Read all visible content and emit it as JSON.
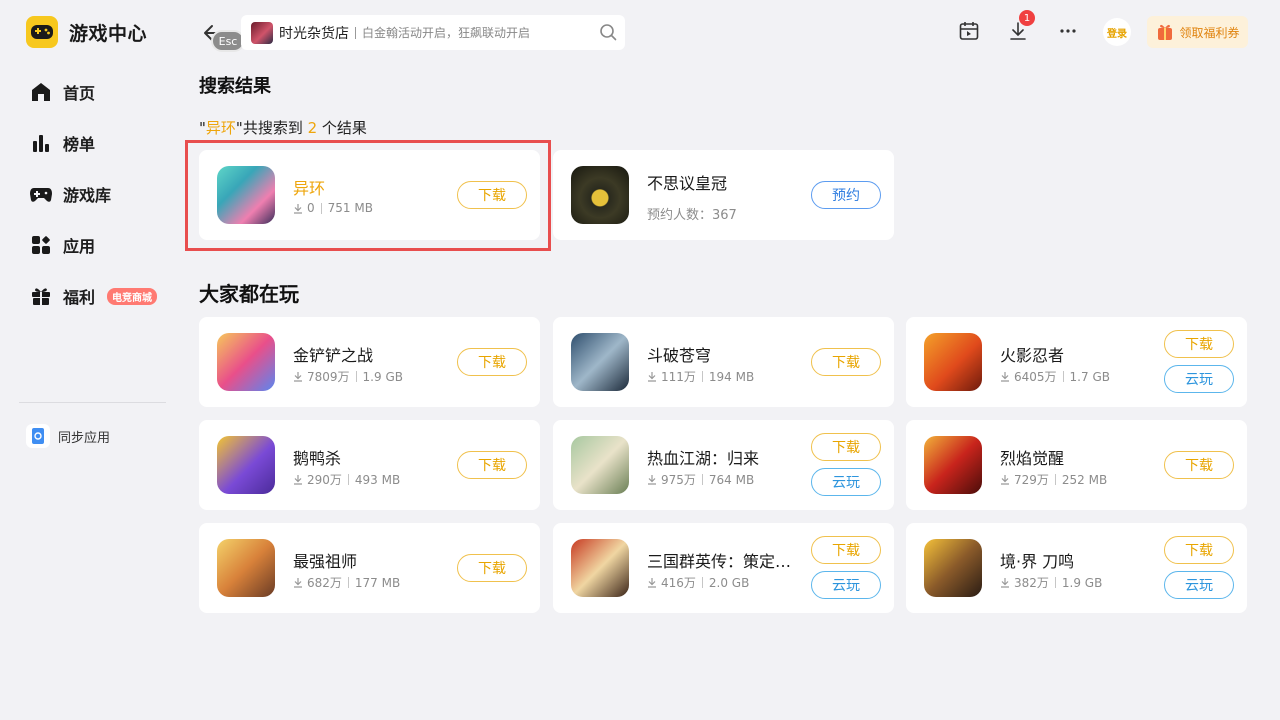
{
  "app": {
    "title": "游戏中心"
  },
  "sidebar": {
    "items": [
      {
        "label": "首页"
      },
      {
        "label": "榜单"
      },
      {
        "label": "游戏库"
      },
      {
        "label": "应用"
      },
      {
        "label": "福利",
        "badge": "电竞商城"
      }
    ],
    "sync_label": "同步应用"
  },
  "topbar": {
    "esc_label": "Esc",
    "search": {
      "hot_word": "时光杂货店",
      "subtext": "白金翰活动开启，狂飙联动开启"
    },
    "download_badge": "1",
    "login_label": "登录",
    "coupon_label": "领取福利券"
  },
  "search_results": {
    "title": "搜索结果",
    "summary": {
      "prefix": "\"",
      "query": "异环",
      "middle": "\"共搜索到 ",
      "count": "2",
      "suffix": " 个结果"
    },
    "items": [
      {
        "name": "异环",
        "downloads": "0",
        "size": "751 MB",
        "button": "下载"
      },
      {
        "name": "不思议皇冠",
        "reserve_text": "预约人数：367",
        "button": "预约"
      }
    ]
  },
  "popular": {
    "title": "大家都在玩",
    "items": [
      {
        "name": "金铲铲之战",
        "downloads": "7809万",
        "size": "1.9 GB",
        "download_label": "下载"
      },
      {
        "name": "斗破苍穹",
        "downloads": "111万",
        "size": "194 MB",
        "download_label": "下载"
      },
      {
        "name": "火影忍者",
        "downloads": "6405万",
        "size": "1.7 GB",
        "download_label": "下载",
        "cloud_label": "云玩"
      },
      {
        "name": "鹅鸭杀",
        "downloads": "290万",
        "size": "493 MB",
        "download_label": "下载"
      },
      {
        "name": "热血江湖：归来",
        "downloads": "975万",
        "size": "764 MB",
        "download_label": "下载",
        "cloud_label": "云玩"
      },
      {
        "name": "烈焰觉醒",
        "downloads": "729万",
        "size": "252 MB",
        "download_label": "下载"
      },
      {
        "name": "最强祖师",
        "downloads": "682万",
        "size": "177 MB",
        "download_label": "下载"
      },
      {
        "name": "三国群英传：策定…",
        "downloads": "416万",
        "size": "2.0 GB",
        "download_label": "下载",
        "cloud_label": "云玩"
      },
      {
        "name": "境·界 刀鸣",
        "downloads": "382万",
        "size": "1.9 GB",
        "download_label": "下载",
        "cloud_label": "云玩"
      }
    ]
  },
  "colors": {
    "accent": "#eea50b",
    "highlight_border": "#e84e4e",
    "cloud": "#2d95dd"
  }
}
